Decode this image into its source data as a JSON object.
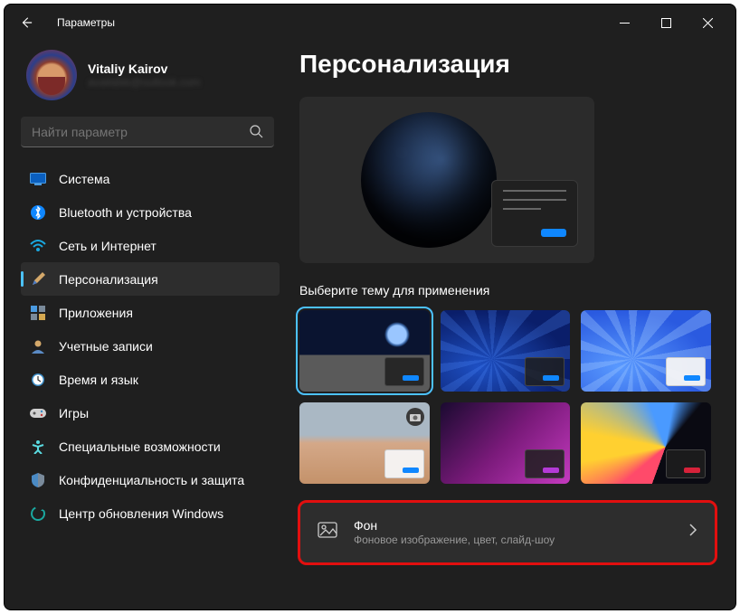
{
  "window": {
    "title": "Параметры"
  },
  "profile": {
    "name": "Vitaliy Kairov",
    "email": "available@outlook.com"
  },
  "search": {
    "placeholder": "Найти параметр"
  },
  "nav": {
    "items": [
      {
        "label": "Система",
        "icon": "system"
      },
      {
        "label": "Bluetooth и устройства",
        "icon": "bluetooth"
      },
      {
        "label": "Сеть и Интернет",
        "icon": "network"
      },
      {
        "label": "Персонализация",
        "icon": "personalization",
        "active": true
      },
      {
        "label": "Приложения",
        "icon": "apps"
      },
      {
        "label": "Учетные записи",
        "icon": "accounts"
      },
      {
        "label": "Время и язык",
        "icon": "time"
      },
      {
        "label": "Игры",
        "icon": "gaming"
      },
      {
        "label": "Специальные возможности",
        "icon": "accessibility"
      },
      {
        "label": "Конфиденциальность и защита",
        "icon": "privacy"
      },
      {
        "label": "Центр обновления Windows",
        "icon": "update"
      }
    ]
  },
  "page": {
    "title": "Персонализация",
    "theme_section_label": "Выберите тему для применения",
    "themes": [
      {
        "id": "earth-dark",
        "accent": "#0f87ff",
        "win": "dark",
        "active": true
      },
      {
        "id": "bloom-dark",
        "accent": "#0f87ff",
        "win": "dark"
      },
      {
        "id": "bloom-light",
        "accent": "#0f87ff",
        "win": "light"
      },
      {
        "id": "photo-light",
        "accent": "#0f87ff",
        "win": "light",
        "camera": true
      },
      {
        "id": "glow-purple",
        "accent": "#b43ad6",
        "win": "dark"
      },
      {
        "id": "flow-red",
        "accent": "#d6223a",
        "win": "dark"
      }
    ],
    "background_row": {
      "title": "Фон",
      "subtitle": "Фоновое изображение, цвет, слайд-шоу"
    }
  }
}
